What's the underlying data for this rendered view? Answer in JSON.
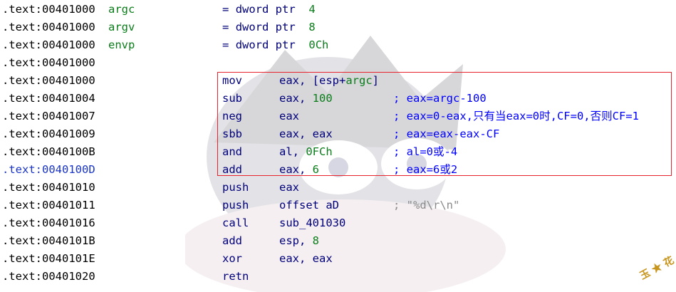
{
  "header_lines": [
    {
      "addr": ".text:00401000",
      "name": "argc",
      "eq": "=",
      "type": "dword ptr",
      "value": "4"
    },
    {
      "addr": ".text:00401000",
      "name": "argv",
      "eq": "=",
      "type": "dword ptr",
      "value": "8"
    },
    {
      "addr": ".text:00401000",
      "name": "envp",
      "eq": "=",
      "type": "dword ptr",
      "value": "0Ch"
    },
    {
      "addr": ".text:00401000"
    }
  ],
  "code_lines": [
    {
      "addr": ".text:00401000",
      "mnemonic": "mov",
      "op_pre": "eax, [esp+",
      "op_green": "argc",
      "op_post": "]",
      "comment": ""
    },
    {
      "addr": ".text:00401004",
      "mnemonic": "sub",
      "op_pre": "eax, ",
      "op_green": "100",
      "op_post": "",
      "comment": "; eax=argc-100"
    },
    {
      "addr": ".text:00401007",
      "mnemonic": "neg",
      "op_pre": "eax",
      "op_green": "",
      "op_post": "",
      "comment": "; eax=0-eax,只有当eax=0时,CF=0,否则CF=1"
    },
    {
      "addr": ".text:00401009",
      "mnemonic": "sbb",
      "op_pre": "eax, eax",
      "op_green": "",
      "op_post": "",
      "comment": "; eax=eax-eax-CF"
    },
    {
      "addr": ".text:0040100B",
      "mnemonic": "and",
      "op_pre": "al, ",
      "op_green": "0FCh",
      "op_post": "",
      "comment": "; al=0或-4"
    },
    {
      "addr": ".text:0040100D",
      "mnemonic": "add",
      "op_pre": "eax, ",
      "op_green": "6",
      "op_post": "",
      "comment": "; eax=6或2"
    },
    {
      "addr": ".text:00401010",
      "mnemonic": "push",
      "op_pre": "eax",
      "op_green": "",
      "op_post": "",
      "comment": ""
    },
    {
      "addr": ".text:00401011",
      "mnemonic": "push",
      "op_pre": "offset aD",
      "op_green": "",
      "op_post": "",
      "comment": "; \"%d\\r\\n\""
    },
    {
      "addr": ".text:00401016",
      "mnemonic": "call",
      "op_pre": "sub_401030",
      "op_green": "",
      "op_post": "",
      "comment": ""
    },
    {
      "addr": ".text:0040101B",
      "mnemonic": "add",
      "op_pre": "esp, ",
      "op_green": "8",
      "op_post": "",
      "comment": ""
    },
    {
      "addr": ".text:0040101E",
      "mnemonic": "xor",
      "op_pre": "eax, eax",
      "op_green": "",
      "op_post": "",
      "comment": ""
    },
    {
      "addr": ".text:00401020",
      "mnemonic": "retn",
      "op_pre": "",
      "op_green": "",
      "op_post": "",
      "comment": ""
    }
  ],
  "watermark_logo_text": "玉 ★ 花",
  "colors": {
    "highlight_box": "#e8232d",
    "keyword": "#00007a",
    "identifier": "#0a7d1a",
    "comment": "#0000ff",
    "selected_address": "#1a35c8"
  }
}
